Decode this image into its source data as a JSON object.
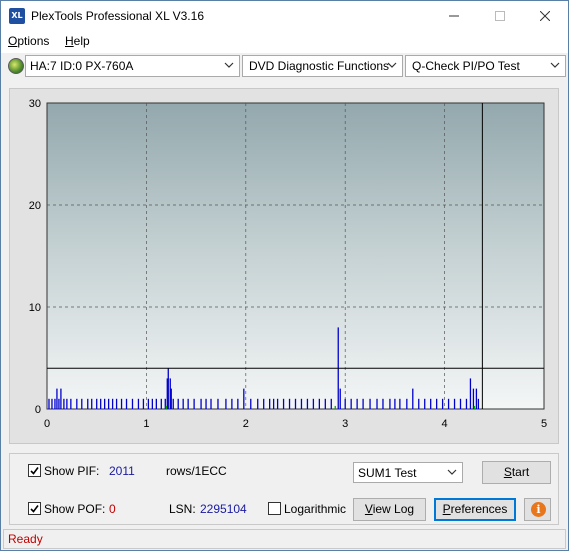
{
  "window": {
    "title": "PlexTools Professional XL V3.16",
    "icon_label": "XL",
    "controls": [
      "minimize-icon",
      "maximize-icon",
      "close-icon"
    ]
  },
  "menu": {
    "options": "ptions",
    "options_mnemonic": "O",
    "help": "elp",
    "help_mnemonic": "H"
  },
  "toolbar": {
    "drive": "HA:7 ID:0  PX-760A",
    "function": "DVD Diagnostic Functions",
    "test": "Q-Check PI/PO Test"
  },
  "chart_data": {
    "type": "bar",
    "title": "",
    "xlabel": "",
    "ylabel": "",
    "xlim": [
      0,
      5
    ],
    "ylim": [
      0,
      30
    ],
    "x_ticks": [
      "0",
      "1",
      "2",
      "3",
      "4",
      "5"
    ],
    "y_ticks": [
      "0",
      "10",
      "20",
      "30"
    ],
    "grid": true,
    "threshold_line": 4,
    "end_marker_x": 4.38,
    "series": [
      {
        "color": "#0000cc",
        "points": [
          [
            0.02,
            1
          ],
          [
            0.05,
            1
          ],
          [
            0.08,
            1
          ],
          [
            0.1,
            2
          ],
          [
            0.12,
            1
          ],
          [
            0.14,
            2
          ],
          [
            0.17,
            1
          ],
          [
            0.2,
            1
          ],
          [
            0.24,
            1
          ],
          [
            0.3,
            1
          ],
          [
            0.35,
            1
          ],
          [
            0.41,
            1
          ],
          [
            0.45,
            1
          ],
          [
            0.5,
            1
          ],
          [
            0.54,
            1
          ],
          [
            0.58,
            1
          ],
          [
            0.62,
            1
          ],
          [
            0.66,
            1
          ],
          [
            0.7,
            1
          ],
          [
            0.75,
            1
          ],
          [
            0.8,
            1
          ],
          [
            0.86,
            1
          ],
          [
            0.92,
            1
          ],
          [
            0.97,
            1
          ],
          [
            1.02,
            1
          ],
          [
            1.06,
            1
          ],
          [
            1.1,
            1
          ],
          [
            1.15,
            1
          ],
          [
            1.19,
            1
          ],
          [
            1.21,
            3
          ],
          [
            1.22,
            4
          ],
          [
            1.24,
            3
          ],
          [
            1.25,
            2
          ],
          [
            1.27,
            1
          ],
          [
            1.32,
            1
          ],
          [
            1.37,
            1
          ],
          [
            1.42,
            1
          ],
          [
            1.48,
            1
          ],
          [
            1.55,
            1
          ],
          [
            1.6,
            1
          ],
          [
            1.65,
            1
          ],
          [
            1.72,
            1
          ],
          [
            1.8,
            1
          ],
          [
            1.86,
            1
          ],
          [
            1.92,
            1
          ],
          [
            1.98,
            2
          ],
          [
            2.05,
            1
          ],
          [
            2.12,
            1
          ],
          [
            2.18,
            1
          ],
          [
            2.24,
            1
          ],
          [
            2.28,
            1
          ],
          [
            2.32,
            1
          ],
          [
            2.38,
            1
          ],
          [
            2.44,
            1
          ],
          [
            2.5,
            1
          ],
          [
            2.56,
            1
          ],
          [
            2.62,
            1
          ],
          [
            2.68,
            1
          ],
          [
            2.74,
            1
          ],
          [
            2.8,
            1
          ],
          [
            2.86,
            1
          ],
          [
            2.93,
            8
          ],
          [
            2.95,
            2
          ],
          [
            3.0,
            1
          ],
          [
            3.06,
            1
          ],
          [
            3.12,
            1
          ],
          [
            3.18,
            1
          ],
          [
            3.25,
            1
          ],
          [
            3.32,
            1
          ],
          [
            3.38,
            1
          ],
          [
            3.45,
            1
          ],
          [
            3.5,
            1
          ],
          [
            3.55,
            1
          ],
          [
            3.62,
            1
          ],
          [
            3.68,
            2
          ],
          [
            3.74,
            1
          ],
          [
            3.8,
            1
          ],
          [
            3.86,
            1
          ],
          [
            3.92,
            1
          ],
          [
            3.98,
            1
          ],
          [
            4.04,
            1
          ],
          [
            4.1,
            1
          ],
          [
            4.16,
            1
          ],
          [
            4.22,
            1
          ],
          [
            4.26,
            3
          ],
          [
            4.29,
            2
          ],
          [
            4.32,
            2
          ],
          [
            4.34,
            1
          ]
        ]
      },
      {
        "color": "#00aa00",
        "points": [
          [
            1.2,
            0.3
          ],
          [
            2.9,
            0.3
          ],
          [
            4.3,
            0.3
          ]
        ]
      }
    ]
  },
  "controls": {
    "show_pif_label": "Show PIF:",
    "pif_value": "2011",
    "rows_label": "rows/1ECC",
    "show_pof_label": "Show POF:",
    "pof_value": "0",
    "lsn_label": "LSN:",
    "lsn_value": "2295104",
    "logarithmic_label": "Logarithmic",
    "sum_select": "SUM1 Test",
    "start_button": "tart",
    "start_mnemonic": "S",
    "viewlog_prefix": "",
    "viewlog_mnemonic": "V",
    "viewlog_rest": "iew Log",
    "preferences_prefix": "",
    "preferences_mnemonic": "P",
    "preferences_rest": "references",
    "show_pif_checked": true,
    "show_pof_checked": true,
    "logarithmic_checked": false
  },
  "status": {
    "text": "Ready"
  }
}
